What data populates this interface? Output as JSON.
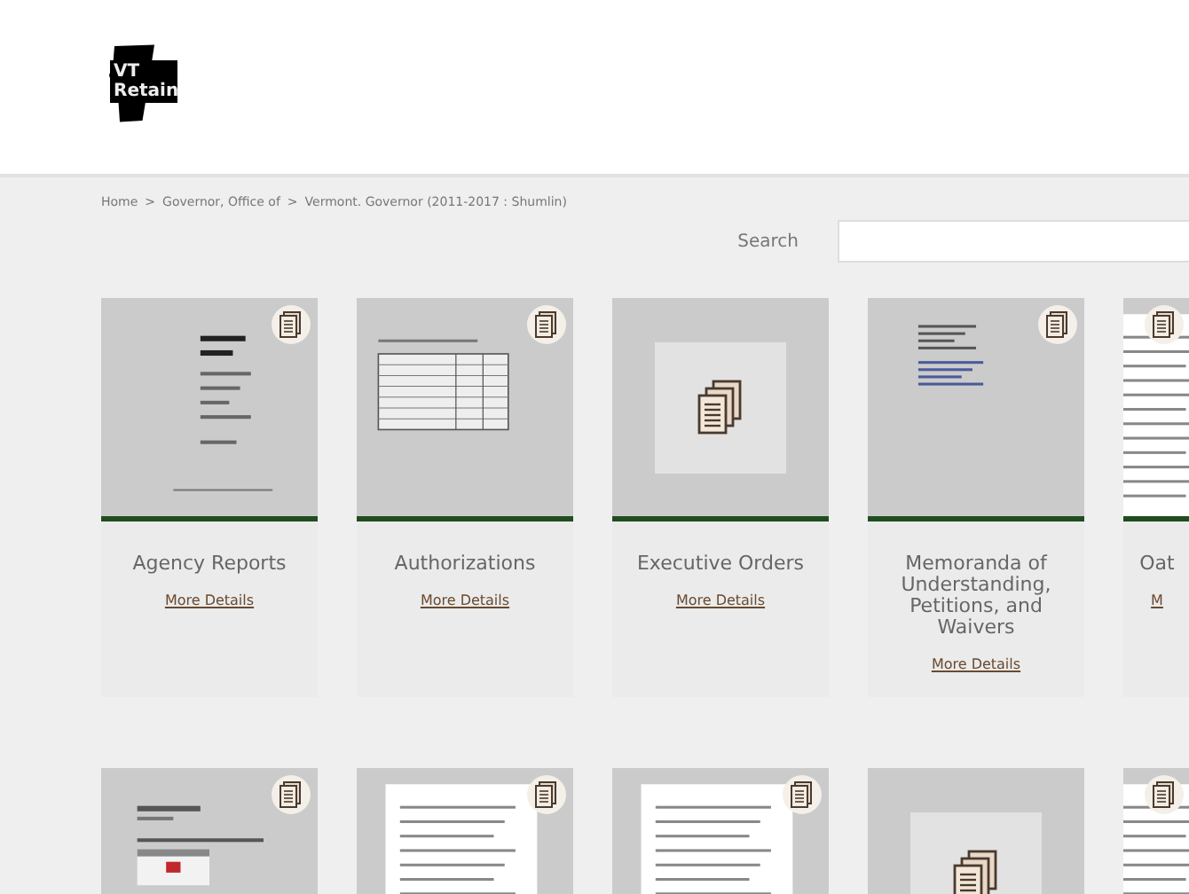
{
  "logo": {
    "text": "VT Retain"
  },
  "breadcrumb": [
    "Home",
    "Governor, Office of",
    "Vermont. Governor (2011-2017 : Shumlin)"
  ],
  "breadcrumb_separator": ">",
  "search": {
    "label": "Search"
  },
  "rows": [
    {
      "cards": [
        {
          "kind": "preview",
          "title": "Agency Reports",
          "link": "More Details"
        },
        {
          "kind": "preview",
          "title": "Authorizations",
          "link": "More Details"
        },
        {
          "kind": "placeholder",
          "title": "Executive Orders",
          "link": "More Details"
        },
        {
          "kind": "preview",
          "title": "Memoranda of Understanding, Petitions, and Waivers",
          "link": "More Details"
        },
        {
          "kind": "preview",
          "title": "Oat",
          "link": "M"
        }
      ]
    },
    {
      "cards": [
        {
          "kind": "preview"
        },
        {
          "kind": "preview"
        },
        {
          "kind": "preview"
        },
        {
          "kind": "placeholder"
        },
        {
          "kind": "preview"
        }
      ]
    }
  ]
}
